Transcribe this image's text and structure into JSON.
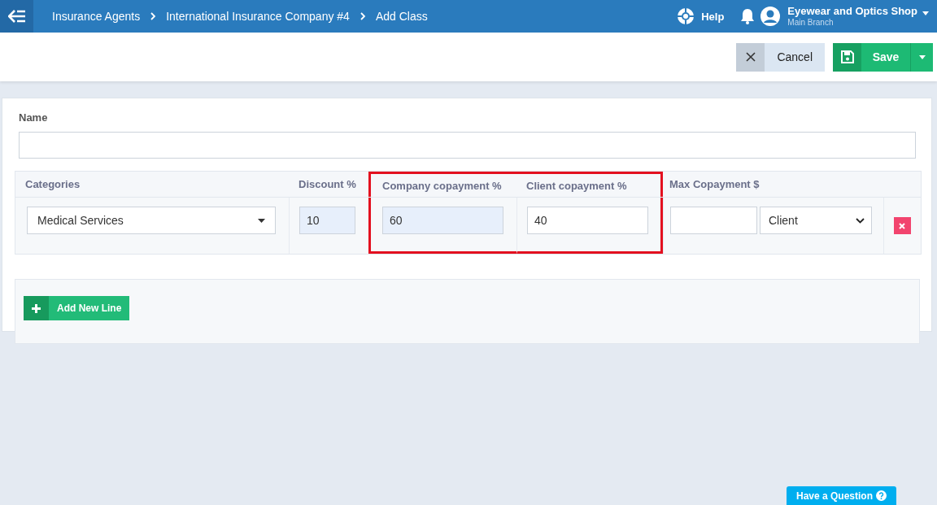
{
  "header": {
    "breadcrumbs": [
      "Insurance Agents",
      "International Insurance Company #4",
      "Add Class"
    ],
    "help": "Help",
    "account": "Eyewear and Optics Shop",
    "branch": "Main Branch"
  },
  "toolbar": {
    "cancel": "Cancel",
    "save": "Save"
  },
  "form": {
    "name_label": "Name",
    "columns": [
      {
        "label": "Categories",
        "highlighted": false
      },
      {
        "label": "Discount %",
        "highlighted": false
      },
      {
        "label": "Company copayment %",
        "highlighted": true
      },
      {
        "label": "Client copayment %",
        "highlighted": true
      },
      {
        "label": "Max Copayment $",
        "highlighted": false
      }
    ],
    "rows": [
      {
        "category": "Medical Services",
        "discount": {
          "value": "10",
          "readonly": true
        },
        "company_copayment": {
          "value": "60",
          "readonly": true
        },
        "client_copayment": {
          "value": "40",
          "readonly": false
        },
        "max_copayment_for": "Client"
      }
    ],
    "add_line": "Add New Line"
  },
  "help_button": "Have a Question"
}
